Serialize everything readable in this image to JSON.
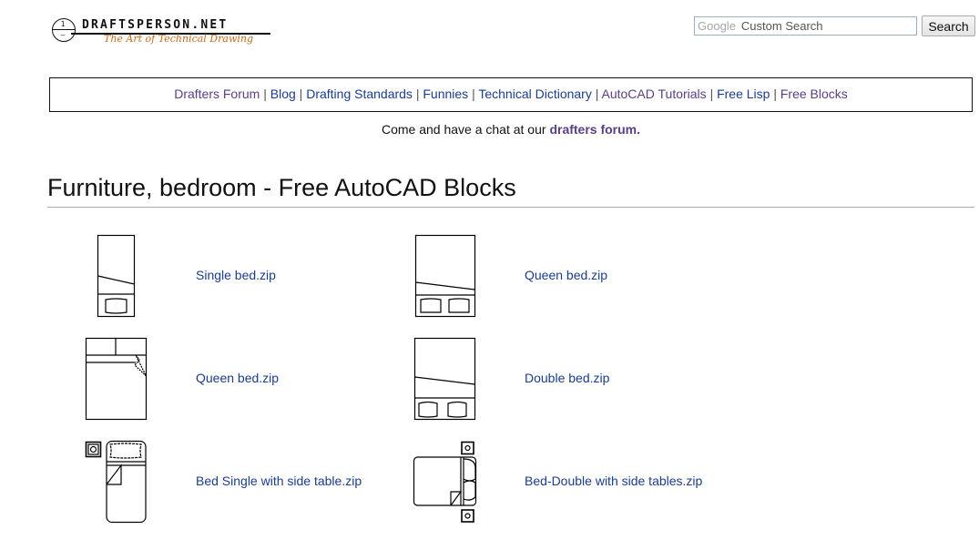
{
  "logo": {
    "symbol_top": "1",
    "symbol_bottom": "–",
    "name": "DRAFTSPERSON.NET",
    "tagline": "The Art of Technical Drawing"
  },
  "search": {
    "provider_label": "Google",
    "placeholder": "Custom Search",
    "button_label": "Search"
  },
  "nav": {
    "items": [
      {
        "label": "Drafters Forum",
        "visited": true
      },
      {
        "label": "Blog",
        "visited": false
      },
      {
        "label": "Drafting Standards",
        "visited": false
      },
      {
        "label": "Funnies",
        "visited": false
      },
      {
        "label": "Technical Dictionary",
        "visited": false
      },
      {
        "label": "AutoCAD Tutorials",
        "visited": true
      },
      {
        "label": "Free Lisp",
        "visited": false
      },
      {
        "label": "Free Blocks",
        "visited": true
      }
    ],
    "separator": "|"
  },
  "chat": {
    "text": "Come and have a chat at our ",
    "link": "drafters forum."
  },
  "page": {
    "title": "Furniture, bedroom - Free AutoCAD Blocks"
  },
  "blocks": [
    {
      "label": "Single bed.zip",
      "icon": "single-bed"
    },
    {
      "label": "Queen bed.zip",
      "icon": "queen-bed"
    },
    {
      "label": "Queen bed.zip",
      "icon": "queen-bed-sheet-fold"
    },
    {
      "label": "Double bed.zip",
      "icon": "double-bed"
    },
    {
      "label": "Bed Single with side table.zip",
      "icon": "single-bed-side-table"
    },
    {
      "label": "Bed-Double with side tables.zip",
      "icon": "double-bed-side-tables"
    }
  ]
}
